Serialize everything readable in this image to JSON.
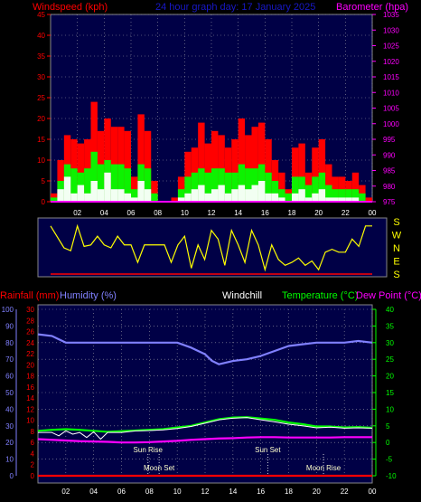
{
  "header": {
    "windspeed_label": "Windspeed (kph)",
    "title": "24 hour graph day: 17 January 2025",
    "barometer_label": "Barometer (hpa)"
  },
  "lower_header": {
    "rainfall_label": "Rainfall (mm)",
    "humidity_label": "Humidity (%)",
    "windchill_label": "Windchill",
    "temperature_label": "Temperature (°C)",
    "dewpoint_label": "Dew Point (°C)"
  },
  "annotations": {
    "sun_rise": "Sun Rise",
    "sun_set": "Sun Set",
    "moon_set": "Moon Set",
    "moon_rise": "Moon Rise"
  },
  "chart_data": [
    {
      "type": "area",
      "panel": "wind",
      "x_ticks": [
        "02",
        "04",
        "06",
        "08",
        "10",
        "12",
        "14",
        "16",
        "18",
        "20",
        "22",
        "00"
      ],
      "xlim_hours": [
        0,
        24
      ],
      "ylabel_left": "Windspeed (kph)",
      "ylabel_right": "Barometer (hpa)",
      "ylim_left": [
        0,
        45
      ],
      "yticks_left": [
        "0",
        "5",
        "10",
        "15",
        "20",
        "25",
        "30",
        "35",
        "40",
        "45"
      ],
      "ylim_right": [
        975,
        1035
      ],
      "yticks_right": [
        "975",
        "980",
        "985",
        "990",
        "995",
        "1000",
        "1005",
        "1010",
        "1015",
        "1020",
        "1025",
        "1030",
        "1035"
      ],
      "grid": true,
      "series": [
        {
          "name": "Gust",
          "color": "#ff0000",
          "x": [
            0,
            0.5,
            1,
            1.5,
            2,
            2.5,
            3,
            3.5,
            4,
            4.5,
            5,
            5.5,
            6,
            6.5,
            7,
            7.5,
            8,
            8.5,
            9,
            9.5,
            10,
            10.5,
            11,
            11.5,
            12,
            12.5,
            13,
            13.5,
            14,
            14.5,
            15,
            15.5,
            16,
            16.5,
            17,
            17.5,
            18,
            18.5,
            19,
            19.5,
            20,
            20.5,
            21,
            21.5,
            22,
            22.5,
            23,
            23.5
          ],
          "values": [
            2,
            10,
            16,
            15,
            14,
            15,
            24,
            17,
            20,
            18,
            18,
            17,
            6,
            21,
            17,
            5,
            0,
            0,
            1,
            6,
            12,
            13,
            19,
            14,
            17,
            16,
            13,
            15,
            20,
            16,
            18,
            19,
            15,
            10,
            7,
            3,
            13,
            14,
            7,
            13,
            15,
            9,
            6,
            6,
            5,
            7,
            4,
            1
          ]
        },
        {
          "name": "Average",
          "color": "#00ff00",
          "x": [
            0,
            0.5,
            1,
            1.5,
            2,
            2.5,
            3,
            3.5,
            4,
            4.5,
            5,
            5.5,
            6,
            6.5,
            7,
            7.5,
            8,
            8.5,
            9,
            9.5,
            10,
            10.5,
            11,
            11.5,
            12,
            12.5,
            13,
            13.5,
            14,
            14.5,
            15,
            15.5,
            16,
            16.5,
            17,
            17.5,
            18,
            18.5,
            19,
            19.5,
            20,
            20.5,
            21,
            21.5,
            22,
            22.5,
            23,
            23.5
          ],
          "values": [
            1,
            5,
            9,
            8,
            7,
            8,
            12,
            9,
            10,
            9,
            9,
            8,
            3,
            9,
            8,
            2,
            0,
            0,
            0,
            3,
            6,
            7,
            8,
            7,
            8,
            8,
            7,
            7,
            9,
            8,
            8,
            9,
            7,
            5,
            3,
            2,
            6,
            6,
            4,
            6,
            7,
            4,
            3,
            3,
            3,
            3,
            2,
            0
          ]
        },
        {
          "name": "Wind Speed",
          "color": "#ffffff",
          "x": [
            0,
            0.5,
            1,
            1.5,
            2,
            2.5,
            3,
            3.5,
            4,
            4.5,
            5,
            5.5,
            6,
            6.5,
            7,
            7.5,
            8,
            8.5,
            9,
            9.5,
            10,
            10.5,
            11,
            11.5,
            12,
            12.5,
            13,
            13.5,
            14,
            14.5,
            15,
            15.5,
            16,
            16.5,
            17,
            17.5,
            18,
            18.5,
            19,
            19.5,
            20,
            20.5,
            21,
            21.5,
            22,
            22.5,
            23,
            23.5
          ],
          "values": [
            0,
            3,
            6,
            2,
            4,
            2,
            5,
            3,
            7,
            3,
            3,
            2,
            1,
            5,
            3,
            0,
            0,
            0,
            0,
            1,
            2,
            3,
            4,
            2,
            3,
            4,
            2,
            3,
            4,
            3,
            4,
            5,
            2,
            2,
            1,
            0,
            2,
            3,
            1,
            2,
            3,
            1,
            1,
            1,
            1,
            1,
            0,
            0
          ]
        },
        {
          "name": "Barometer",
          "color": "#ff00ff",
          "x": [
            0,
            24
          ],
          "values": [
            975,
            975
          ]
        }
      ]
    },
    {
      "type": "scatter",
      "panel": "direction",
      "ylabels_right": [
        "S",
        "E",
        "N",
        "W",
        "S"
      ],
      "ylim_degrees": [
        0,
        360
      ],
      "series": [
        {
          "name": "Wind Direction",
          "color": "#ffff00",
          "x": [
            0,
            1,
            1.5,
            2,
            2.5,
            3,
            3.5,
            4,
            4.5,
            5,
            5.5,
            6,
            6.5,
            7,
            7.5,
            8,
            8.5,
            9,
            9.5,
            10,
            10.5,
            11,
            11.5,
            12,
            12.5,
            13,
            13.5,
            14,
            14.5,
            15,
            15.5,
            16,
            16.5,
            17,
            17.5,
            18,
            18.5,
            19,
            19.5,
            20,
            20.5,
            21,
            21.5,
            22,
            22.5,
            23,
            23.5,
            24
          ],
          "values": [
            330,
            180,
            160,
            330,
            190,
            200,
            260,
            200,
            180,
            260,
            200,
            200,
            80,
            200,
            200,
            200,
            200,
            80,
            200,
            260,
            40,
            200,
            100,
            300,
            240,
            60,
            300,
            200,
            80,
            300,
            200,
            30,
            200,
            100,
            60,
            80,
            110,
            60,
            90,
            30,
            150,
            170,
            150,
            150,
            240,
            190,
            330,
            330
          ]
        },
        {
          "name": "Zero line",
          "color": "#ff0000",
          "x": [
            0,
            24
          ],
          "values": [
            0,
            0
          ]
        }
      ]
    },
    {
      "type": "line",
      "panel": "temperature",
      "xlim_hours": [
        0,
        24
      ],
      "y_ticks_humidity": [
        "0",
        "10",
        "20",
        "30",
        "40",
        "50",
        "60",
        "70",
        "80",
        "90",
        "100"
      ],
      "y_ticks_rain": [
        "0",
        "2",
        "4",
        "6",
        "8",
        "10",
        "12",
        "14",
        "16",
        "18",
        "20",
        "22",
        "24",
        "26",
        "28",
        "30"
      ],
      "y_ticks_temp": [
        "-10",
        "-5",
        "0",
        "5",
        "10",
        "15",
        "20",
        "25",
        "30",
        "35",
        "40"
      ],
      "ylim_humidity": [
        0,
        100
      ],
      "ylim_rain": [
        0,
        30
      ],
      "ylim_temp": [
        -10,
        40
      ],
      "series": [
        {
          "name": "Humidity (%)",
          "color": "#8080ff",
          "x": [
            0,
            1,
            1.5,
            2,
            3,
            4,
            5,
            6,
            7,
            8,
            9,
            10,
            11,
            12,
            12.5,
            13,
            14,
            15,
            16,
            17,
            18,
            19,
            20,
            21,
            22,
            23,
            24
          ],
          "values": [
            85,
            84,
            82,
            80,
            80,
            80,
            80,
            80,
            80,
            80,
            80,
            80,
            77,
            73,
            69,
            67,
            69,
            70,
            72,
            75,
            78,
            79,
            80,
            80,
            80,
            81,
            80
          ]
        },
        {
          "name": "Temperature (°C)",
          "color": "#00ff00",
          "x": [
            0,
            1,
            2,
            3,
            4,
            5,
            6,
            7,
            8,
            9,
            10,
            11,
            12,
            13,
            14,
            15,
            16,
            17,
            18,
            19,
            20,
            21,
            22,
            23,
            24
          ],
          "values": [
            3.5,
            3.8,
            4,
            3.8,
            3.5,
            3.2,
            3.4,
            3.6,
            3.8,
            4,
            4.5,
            5,
            6,
            7,
            7.5,
            7.6,
            7.2,
            6.8,
            6,
            5.5,
            4.8,
            4.8,
            4.5,
            4.6,
            4.4
          ]
        },
        {
          "name": "Windchill",
          "color": "#ffffff",
          "x": [
            0,
            1,
            1.5,
            2,
            2.5,
            3,
            3.5,
            4,
            4.5,
            5,
            6,
            7,
            8,
            9,
            10,
            11,
            12,
            13,
            14,
            15,
            16,
            17,
            18,
            19,
            20,
            21,
            22,
            23,
            24
          ],
          "values": [
            3,
            3,
            2,
            3.5,
            2.5,
            3,
            1.5,
            3.2,
            1,
            3,
            3,
            3.5,
            3.6,
            3.8,
            4.2,
            4.8,
            5.8,
            6.8,
            7.3,
            7.5,
            6.8,
            6.2,
            5.5,
            5,
            4.4,
            4.6,
            4.3,
            4.4,
            4.3
          ],
          "label": "Windchill"
        },
        {
          "name": "Dew Point (°C)",
          "color": "#ff00ff",
          "x": [
            0,
            1,
            2,
            3,
            4,
            5,
            6,
            7,
            8,
            9,
            10,
            11,
            12,
            13,
            14,
            15,
            16,
            17,
            18,
            19,
            20,
            21,
            22,
            23,
            24
          ],
          "values": [
            1,
            0.8,
            0.6,
            0.4,
            0.3,
            0.2,
            0,
            0,
            0.1,
            0.3,
            0.5,
            0.8,
            1,
            1.2,
            1.3,
            1.5,
            1.6,
            1.6,
            1.5,
            1.5,
            1.5,
            1.5,
            1.6,
            1.6,
            1.6
          ]
        },
        {
          "name": "Rainfall (mm)",
          "color": "#ff0000",
          "x": [
            0,
            24
          ],
          "values": [
            0,
            0
          ]
        }
      ],
      "events": [
        {
          "label": "Sun Rise",
          "hour": 7.9
        },
        {
          "label": "Moon Set",
          "hour": 8.7
        },
        {
          "label": "Sun Set",
          "hour": 16.5
        },
        {
          "label": "Moon Rise",
          "hour": 20.5
        }
      ]
    }
  ]
}
